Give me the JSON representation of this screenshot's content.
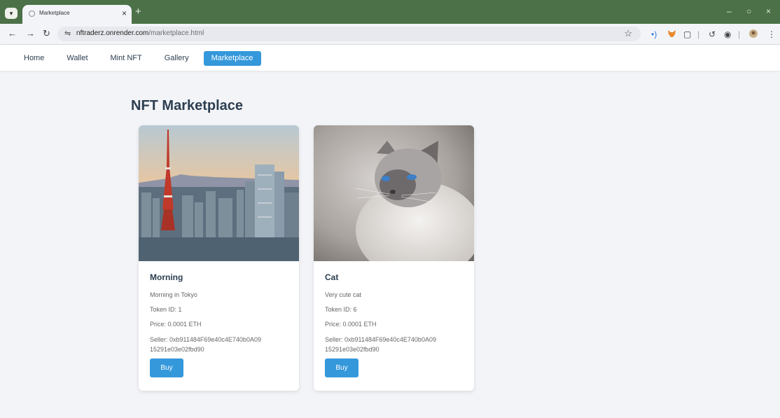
{
  "browser": {
    "tab_title": "Marketplace",
    "url_domain": "nftraderz.onrender.com",
    "url_path": "/marketplace.html"
  },
  "nav": {
    "links": [
      {
        "label": "Home",
        "active": false
      },
      {
        "label": "Wallet",
        "active": false
      },
      {
        "label": "Mint NFT",
        "active": false
      },
      {
        "label": "Gallery",
        "active": false
      },
      {
        "label": "Marketplace",
        "active": true
      }
    ]
  },
  "page": {
    "title": "NFT Marketplace"
  },
  "listings": [
    {
      "name": "Morning",
      "description": "Morning in Tokyo",
      "token_id": "Token ID: 1",
      "price": "Price: 0.0001 ETH",
      "seller": "Seller: 0xb911484F69e40c4E740b0A0915291e03e02fbd90",
      "buy_label": "Buy",
      "image": "tokyo-tower-cityscape-at-dawn"
    },
    {
      "name": "Cat",
      "description": "Very cute cat",
      "token_id": "Token ID: 6",
      "price": "Price: 0.0001 ETH",
      "seller": "Seller: 0xb911484F69e40c4E740b0A0915291e03e02fbd90",
      "buy_label": "Buy",
      "image": "blue-eyed-cat-looking-up"
    }
  ],
  "colors": {
    "accent": "#3498db",
    "heading": "#2c3e50",
    "chrome": "#4c7148",
    "page_bg": "#f3f4f8"
  }
}
